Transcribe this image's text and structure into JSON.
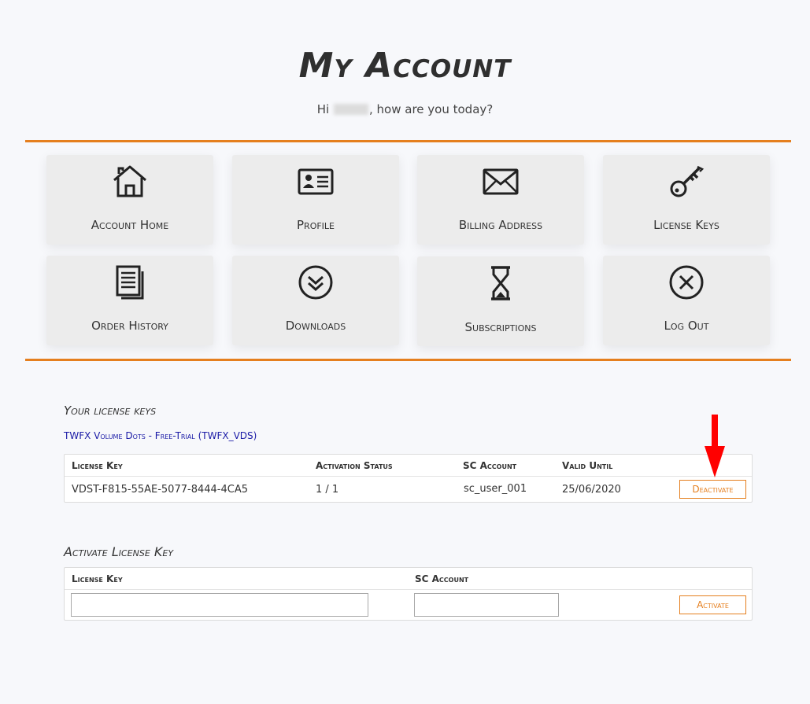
{
  "header": {
    "title": "My Account",
    "greeting_prefix": "Hi",
    "greeting_suffix": ", how are you today?"
  },
  "nav": {
    "tiles": [
      {
        "label": "Account Home",
        "icon": "home-icon"
      },
      {
        "label": "Profile",
        "icon": "id-card-icon"
      },
      {
        "label": "Billing Address",
        "icon": "envelope-icon"
      },
      {
        "label": "License Keys",
        "icon": "key-icon"
      },
      {
        "label": "Order History",
        "icon": "documents-icon"
      },
      {
        "label": "Downloads",
        "icon": "circle-chevrons-down-icon"
      },
      {
        "label": "Subscriptions",
        "icon": "hourglass-icon"
      },
      {
        "label": "Log Out",
        "icon": "circle-x-icon"
      }
    ]
  },
  "license_keys": {
    "section_title": "Your license keys",
    "product_link": "TWFX Volume Dots - Free-Trial (TWFX_VDS)",
    "columns": [
      "License Key",
      "Activation Status",
      "SC Account",
      "Valid Until"
    ],
    "rows": [
      {
        "license_key": "VDST-F815-55AE-5077-8444-4CA5",
        "activation_status": "1 / 1",
        "sc_account": "sc_user_001",
        "valid_until": "25/06/2020",
        "action_label": "Deactivate"
      }
    ]
  },
  "activate": {
    "section_title": "Activate License Key",
    "license_key_label": "License Key",
    "sc_account_label": "SC Account",
    "license_key_value": "",
    "sc_account_value": "",
    "button_label": "Activate"
  },
  "colors": {
    "accent": "#e57f1e",
    "link": "#1a1aa6",
    "annotation_arrow": "#ff0000"
  }
}
